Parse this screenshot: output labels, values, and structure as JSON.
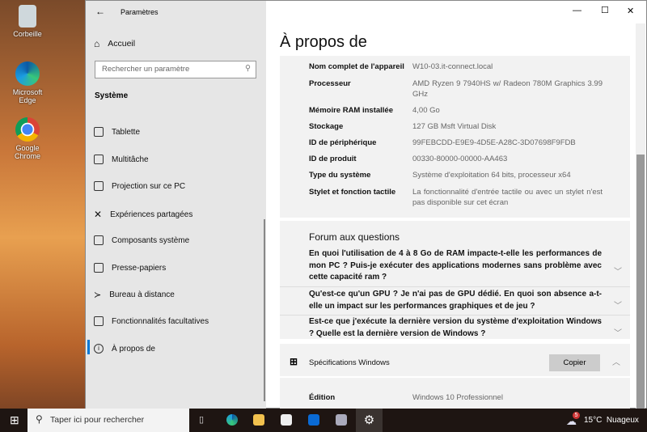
{
  "desktop": {
    "icons": [
      {
        "label": "Corbeille"
      },
      {
        "label": "Microsoft Edge"
      },
      {
        "label": "Google Chrome"
      }
    ]
  },
  "window": {
    "title": "Paramètres",
    "minimize": "—",
    "maximize": "☐",
    "close": "✕",
    "back": "←"
  },
  "sidebar": {
    "home": "Accueil",
    "search_placeholder": "Rechercher un paramètre",
    "section": "Système",
    "items": [
      {
        "label": "Tablette"
      },
      {
        "label": "Multitâche"
      },
      {
        "label": "Projection sur ce PC"
      },
      {
        "label": "Expériences partagées"
      },
      {
        "label": "Composants système"
      },
      {
        "label": "Presse-papiers"
      },
      {
        "label": "Bureau à distance"
      },
      {
        "label": "Fonctionnalités facultatives"
      },
      {
        "label": "À propos de"
      }
    ]
  },
  "main": {
    "title": "À propos de",
    "specs": [
      {
        "label": "Nom complet de l'appareil",
        "value": "W10-03.it-connect.local"
      },
      {
        "label": "Processeur",
        "value": "AMD Ryzen 9 7940HS w/ Radeon 780M Graphics 3.99 GHz"
      },
      {
        "label": "Mémoire RAM installée",
        "value": "4,00 Go"
      },
      {
        "label": "Stockage",
        "value": "127 GB Msft Virtual Disk"
      },
      {
        "label": "ID de périphérique",
        "value": "99FEBCDD-E9E9-4D5E-A28C-3D07698F9FDB"
      },
      {
        "label": "ID de produit",
        "value": "00330-80000-00000-AA463"
      },
      {
        "label": "Type du système",
        "value": "Système d'exploitation 64 bits, processeur x64"
      },
      {
        "label": "Stylet et fonction tactile",
        "value": "La fonctionnalité d'entrée tactile ou avec un stylet n'est pas disponible sur cet écran"
      }
    ],
    "faq_title": "Forum aux questions",
    "faq": [
      {
        "q": "En quoi l'utilisation de 4 à 8 Go de RAM impacte-t-elle les performances de mon PC ? Puis-je exécuter des applications modernes sans problème avec cette capacité ram ?"
      },
      {
        "q": "Qu'est-ce qu'un GPU ? Je n'ai pas de GPU dédié. En quoi son absence a-t-elle un impact sur les performances graphiques et de jeu ?"
      },
      {
        "q": "Est-ce que j'exécute la dernière version du système d'exploitation Windows ? Quelle est la dernière version de Windows ?"
      }
    ],
    "win_specs_title": "Spécifications Windows",
    "copy": "Copier",
    "edition_label": "Édition",
    "edition_value": "Windows 10 Professionnel"
  },
  "taskbar": {
    "search": "Taper ici pour rechercher",
    "weather": "15°C  Nuageux",
    "badge": "5"
  },
  "colors": {
    "accent": "#0078d7"
  }
}
